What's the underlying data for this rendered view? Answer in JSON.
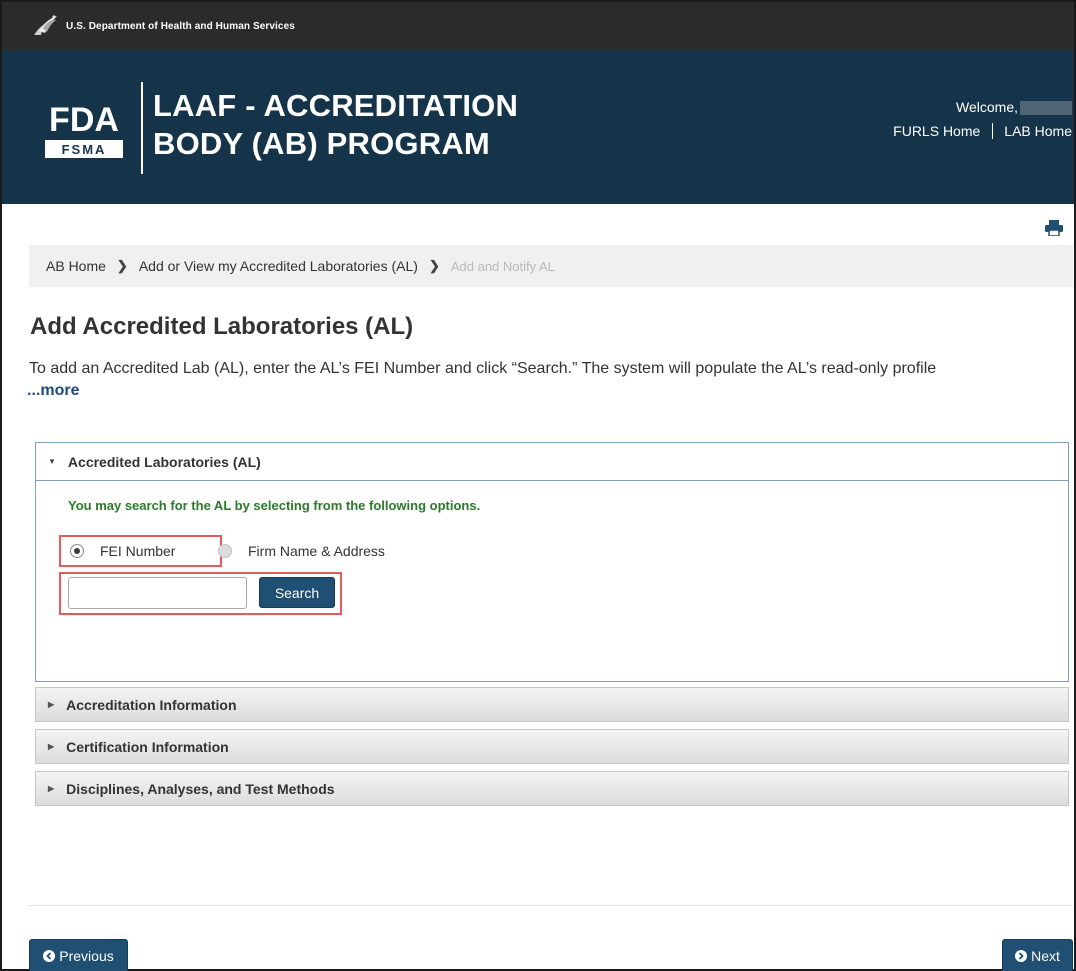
{
  "topbar": {
    "text": "U.S. Department of Health and Human Services",
    "icon": "hhs-eagle-icon"
  },
  "banner": {
    "logo_text": "FDA",
    "logo_subtext": "FSMA",
    "title_line1": "LAAF - ACCREDITATION",
    "title_line2": "BODY (AB) PROGRAM",
    "welcome": "Welcome,",
    "links": [
      "FURLS Home",
      "LAB Home"
    ]
  },
  "breadcrumb": {
    "items": [
      "AB Home",
      "Add or View my Accredited Laboratories (AL)"
    ],
    "current": "Add and Notify AL"
  },
  "page": {
    "title": "Add Accredited Laboratories (AL)",
    "intro": "To add an Accredited Lab (AL), enter the AL’s FEI Number and click “Search.” The system will populate the AL’s read-only profile",
    "more": "...more"
  },
  "panel_open": {
    "title": "Accredited Laboratories (AL)",
    "hint": "You may search for the AL by selecting from the following options.",
    "options": [
      {
        "label": "FEI Number",
        "checked": true
      },
      {
        "label": "Firm Name & Address",
        "checked": false
      }
    ],
    "search_value": "",
    "search_button": "Search"
  },
  "panels_closed": [
    "Accreditation Information",
    "Certification Information",
    "Disciplines, Analyses, and Test Methods"
  ],
  "nav": {
    "previous": "Previous",
    "next": "Next"
  },
  "colors": {
    "banner": "#15344a",
    "button": "#1f4f73",
    "highlight": "#e35b5b",
    "hint": "#2b7a2b"
  }
}
